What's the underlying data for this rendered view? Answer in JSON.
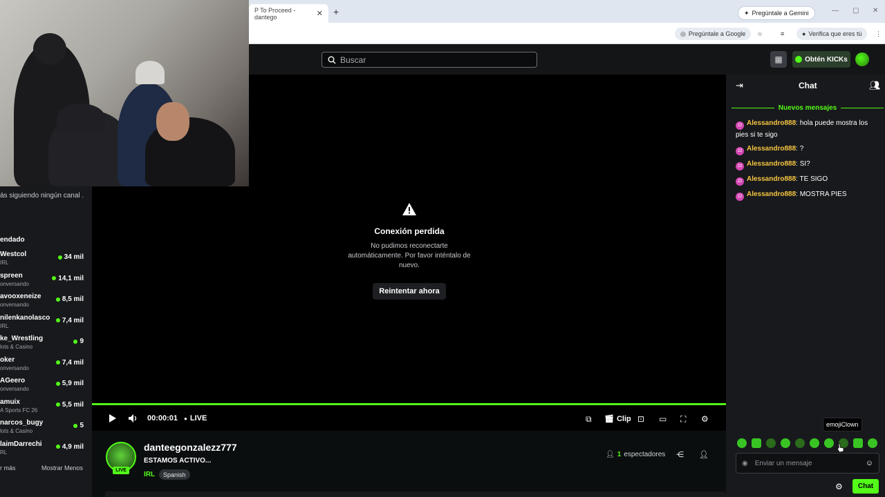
{
  "browser": {
    "tab_title": "P To Proceed - dantego",
    "gemini_button": "Pregúntale a Gemini",
    "ask_google": "Pregúntale a Google",
    "verify": "Verifica que eres tú"
  },
  "header": {
    "search_placeholder": "Buscar",
    "kicks_button": "Obtén KICKs"
  },
  "sidebar": {
    "note": "ás siguiendo ningún canal .",
    "heading": "endado",
    "channels": [
      {
        "name": "Westcol",
        "category": "IRL",
        "viewers": "34 mil"
      },
      {
        "name": "spreen",
        "category": "onversando",
        "viewers": "14,1 mil"
      },
      {
        "name": "avooxeneize",
        "category": "onversando",
        "viewers": "8,5 mil"
      },
      {
        "name": "nilenkanolasco",
        "category": "IRL",
        "viewers": "7,4 mil"
      },
      {
        "name": "ke_Wrestling",
        "category": "lots & Casino",
        "viewers": "9"
      },
      {
        "name": "oker",
        "category": "onversando",
        "viewers": "7,4 mil"
      },
      {
        "name": "AGeero",
        "category": "onversando",
        "viewers": "5,9 mil"
      },
      {
        "name": "amuix",
        "category": "A Sports FC 26",
        "viewers": "5,5 mil"
      },
      {
        "name": "narcos_bugy",
        "category": "lots & Casino",
        "viewers": "5"
      },
      {
        "name": "laimDarrechi",
        "category": "RL",
        "viewers": "4,9 mil"
      }
    ],
    "show_more": "r más",
    "show_less": "Mostrar Menos"
  },
  "player": {
    "error_title": "Conexión perdida",
    "error_text": "No pudimos reconectarte automáticamente. Por favor inténtalo de nuevo.",
    "retry": "Reintentar ahora",
    "time": "00:00:01",
    "live_label": "LIVE",
    "clip_label": "Clip",
    "progress": 1.0
  },
  "stream": {
    "streamer": "danteegonzalezz777",
    "title": "ESTAMOS ACTIVO...",
    "live_badge": "LIVE",
    "category": "IRL",
    "tag": "Spanish",
    "viewer_count": "1",
    "viewer_label": "espectadores"
  },
  "chat": {
    "title": "Chat",
    "new_messages": "Nuevos mensajes",
    "badge_text": "22",
    "messages": [
      {
        "user": "Alessandro888",
        "text": "hola puede mostra los pies si te sigo"
      },
      {
        "user": "Alessandro888",
        "text": "?"
      },
      {
        "user": "Alessandro888",
        "text": "SI?"
      },
      {
        "user": "Alessandro888",
        "text": "TE SIGO"
      },
      {
        "user": "Alessandro888",
        "text": "MOSTRA PIES"
      }
    ],
    "tooltip": "emojiClown",
    "input_placeholder": "Enviar un mensaje",
    "send_button": "Chat"
  },
  "colors": {
    "kick_green": "#53fc18",
    "username_yellow": "#f5c542",
    "badge_pink": "#d447b3"
  }
}
